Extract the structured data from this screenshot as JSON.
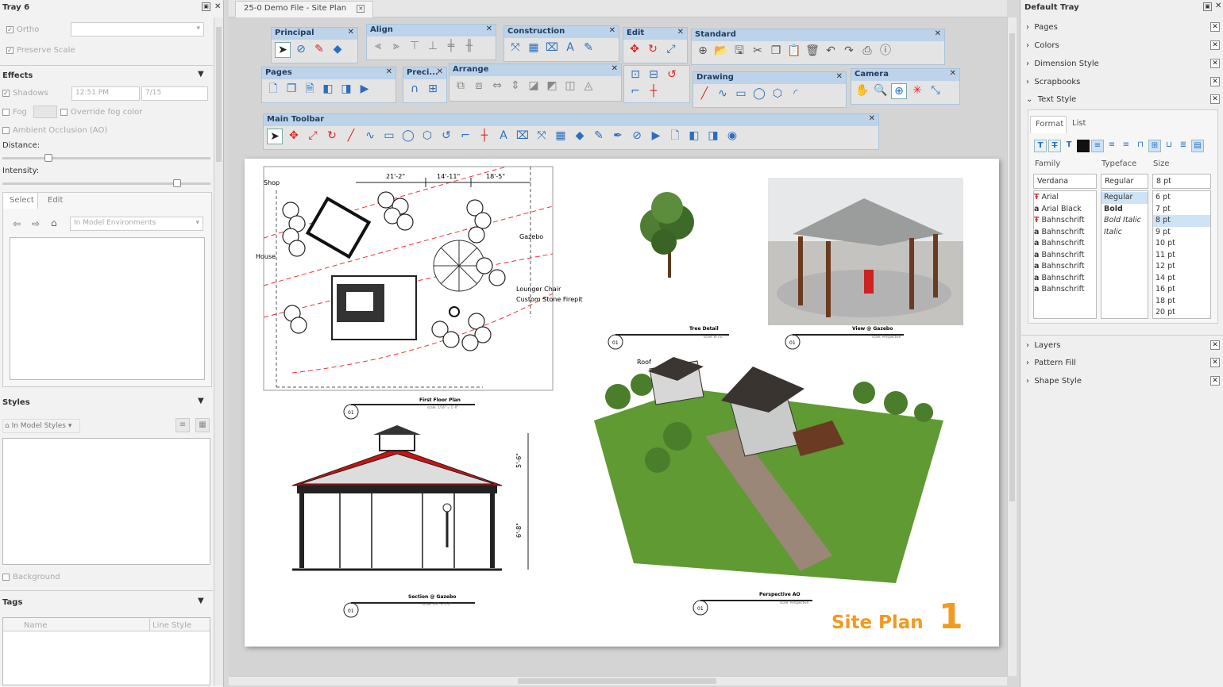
{
  "left_tray": {
    "title": "Tray 6",
    "ortho_label": "Ortho",
    "preserve_scale_label": "Preserve Scale",
    "effects": {
      "title": "Effects",
      "shadows_label": "Shadows",
      "time_value": "12:51 PM",
      "date_value": "7/15",
      "fog_label": "Fog",
      "override_fog_label": "Override fog color",
      "ao_label": "Ambient Occlusion (AO)",
      "distance_label": "Distance:",
      "intensity_label": "Intensity:",
      "distance_value": 0.22,
      "intensity_value": 0.84,
      "tabs": [
        "Select",
        "Edit"
      ],
      "env_select": "In Model Environments"
    },
    "styles": {
      "title": "Styles",
      "select": "In Model Styles",
      "background_label": "Background"
    },
    "tags": {
      "title": "Tags",
      "col_name": "Name",
      "col_line_style": "Line Style"
    }
  },
  "document_tab": "25-0 Demo File - Site Plan",
  "toolbars": {
    "principal": "Principal",
    "align": "Align",
    "construction": "Construction",
    "edit": "Edit",
    "standard": "Standard",
    "pages": "Pages",
    "precision": "Preci...",
    "arrange": "Arrange",
    "drawing": "Drawing",
    "camera": "Camera",
    "main": "Main Toolbar"
  },
  "sheet": {
    "floor_plan": {
      "dim_1": "21'-2\"",
      "dim_2": "14'-11\"",
      "dim_3": "18'-5\"",
      "label_shop": "Shop",
      "label_house": "House",
      "label_gazebo": "Gazebo",
      "label_lounger": "Lounger Chair",
      "label_firepit": "Custom Stone Firepit",
      "title": "First Floor Plan",
      "scale": "scale: 1/16\" = 1'-0\"",
      "ref": "01"
    },
    "tree_detail": {
      "title": "Tree Detail",
      "scale": "scale: N.T.S.",
      "ref": "01"
    },
    "view_gazebo": {
      "title": "View @ Gazebo",
      "scale": "scale: Perspective",
      "ref": "01"
    },
    "section": {
      "title": "Section @ Gazebo",
      "scale": "scale: 1/4\" = 1'-0\"",
      "ref": "01",
      "dim_top": "5'-6\"",
      "dim_bottom": "6'-8\""
    },
    "perspective": {
      "title": "Perspective AO",
      "scale": "scale: Perspective",
      "ref": "01",
      "roof_label": "Roof"
    },
    "sheet_title": "Site Plan",
    "sheet_number": "1"
  },
  "right_tray": {
    "title": "Default Tray",
    "items_top": [
      "Pages",
      "Colors",
      "Dimension Style",
      "Scrapbooks",
      "Text Style"
    ],
    "text_style": {
      "tabs": [
        "Format",
        "List"
      ],
      "family_label": "Family",
      "typeface_label": "Typeface",
      "size_label": "Size",
      "family_value": "Verdana",
      "typeface_value": "Regular",
      "size_value": "8 pt",
      "families": [
        "Arial",
        "Arial Black",
        "Bahnschrift",
        "Bahnschrift",
        "Bahnschrift",
        "Bahnschrift",
        "Bahnschrift",
        "Bahnschrift",
        "Bahnschrift"
      ],
      "typefaces": [
        "Regular",
        "Bold",
        "Bold Italic",
        "Italic"
      ],
      "sizes": [
        "6 pt",
        "7 pt",
        "8 pt",
        "9 pt",
        "10 pt",
        "11 pt",
        "12 pt",
        "14 pt",
        "16 pt",
        "18 pt",
        "20 pt"
      ]
    },
    "items_bottom": [
      "Layers",
      "Pattern Fill",
      "Shape Style"
    ]
  }
}
